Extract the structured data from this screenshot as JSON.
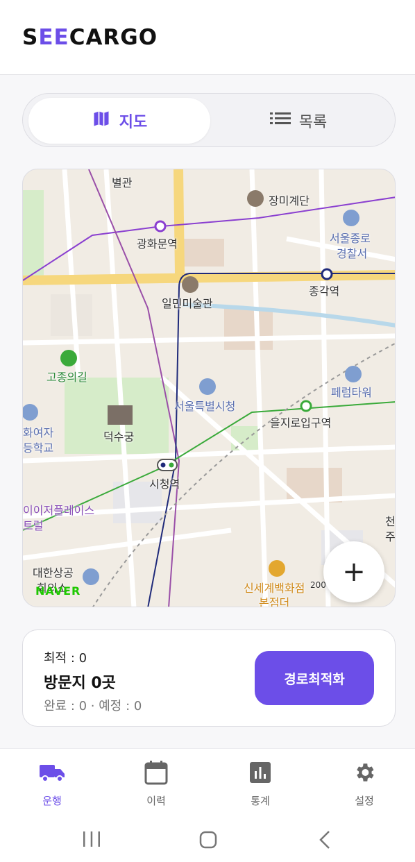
{
  "app": {
    "logo_text_prefix": "S",
    "logo_accent": "EE",
    "logo_text_suffix": "CARGO"
  },
  "toggle": {
    "map_label": "지도",
    "list_label": "목록",
    "selected": "map"
  },
  "map": {
    "labels": {
      "byeolgwan": "별관",
      "jangmi": "장미계단",
      "gwanghwamun": "광화문역",
      "police": "서울종로",
      "police2": "경찰서",
      "jonggak": "종각역",
      "ilmin": "일민미술관",
      "gojong": "고종의길",
      "ferum": "페럼타워",
      "cityhall_bldg": "서울특별시청",
      "euljiro": "을지로입구역",
      "girls_school": "화여자",
      "girls_school2": "등학교",
      "deoksugung": "덕수궁",
      "cityhall_station": "시청역",
      "plaza": "이이저플레이스",
      "plaza2": "트럴",
      "chamber": "대한상공",
      "chamber2": "회의소",
      "shinsegae": "신세계백화점",
      "shinsegae2": "본점더",
      "building_200": "200",
      "right_edge": "천",
      "right_edge2": "주"
    },
    "attribution": "NAVER",
    "zoom_in_symbol": "+"
  },
  "summary": {
    "optimal": "최적 : 0",
    "visits": "방문지 0곳",
    "status": "완료 : 0 · 예정 : 0",
    "optimize_button": "경로최적화"
  },
  "nav": {
    "items": [
      {
        "label": "운행",
        "icon": "truck-icon",
        "active": true
      },
      {
        "label": "이력",
        "icon": "calendar-icon",
        "active": false
      },
      {
        "label": "통계",
        "icon": "bar-chart-icon",
        "active": false
      },
      {
        "label": "설정",
        "icon": "gear-icon",
        "active": false
      }
    ]
  },
  "colors": {
    "accent": "#6c4ee8",
    "map_bg": "#f1ece4",
    "main_road": "#f6d77d"
  }
}
